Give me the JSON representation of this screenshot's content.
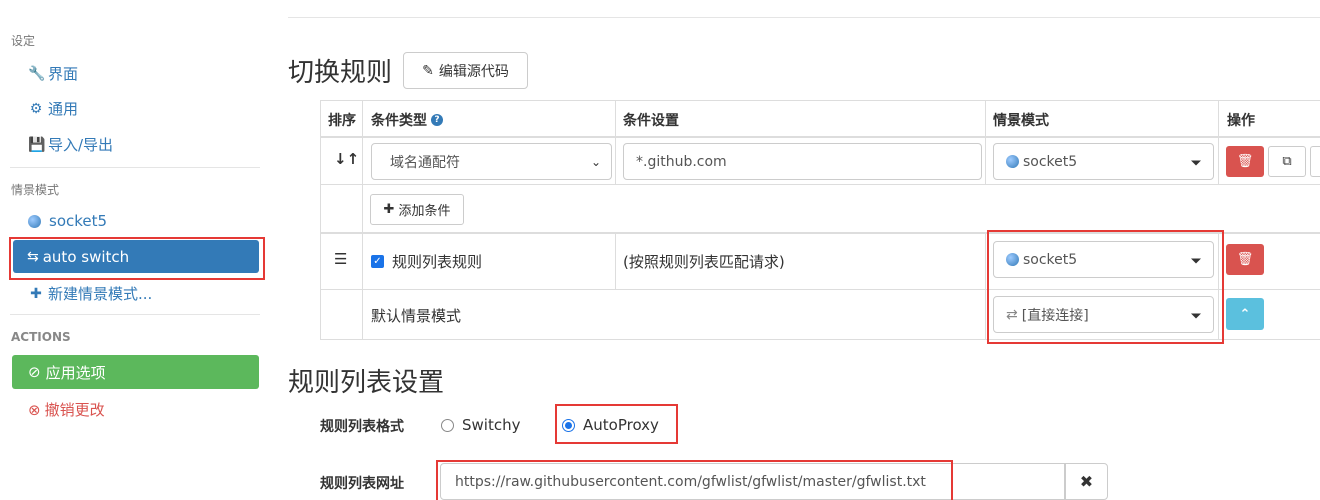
{
  "sidebar": {
    "settings_header": "设定",
    "items_settings": [
      {
        "label": "界面",
        "icon": "wrench-icon"
      },
      {
        "label": "通用",
        "icon": "gear-icon"
      },
      {
        "label": "导入/导出",
        "icon": "floppy-icon"
      }
    ],
    "profiles_header": "情景模式",
    "profiles": [
      {
        "label": "socket5",
        "icon": "globe-icon"
      },
      {
        "label": "auto switch",
        "icon": "retweet-icon",
        "active": true
      },
      {
        "label": "新建情景模式...",
        "icon": "plus-icon"
      }
    ],
    "actions_header": "ACTIONS",
    "apply_label": "应用选项",
    "discard_label": "撤销更改"
  },
  "switch_rules": {
    "title": "切换规则",
    "edit_source_label": "编辑源代码",
    "headers": {
      "sort": "排序",
      "condition_type": "条件类型",
      "condition_setting": "条件设置",
      "profile": "情景模式",
      "actions": "操作"
    },
    "rule": {
      "condition_type": "域名通配符",
      "condition_value": "*.github.com",
      "profile": "socket5"
    },
    "add_condition_label": "添加条件",
    "rule_list_row": {
      "label": "规则列表规则",
      "desc": "(按照规则列表匹配请求)",
      "profile": "socket5"
    },
    "default_row": {
      "label": "默认情景模式",
      "profile": "[直接连接]"
    }
  },
  "rule_list_settings": {
    "title": "规则列表设置",
    "format_label": "规则列表格式",
    "format_options": [
      "Switchy",
      "AutoProxy"
    ],
    "format_selected": "AutoProxy",
    "url_label": "规则列表网址",
    "url_value": "https://raw.githubusercontent.com/gfwlist/gfwlist/master/gfwlist.txt"
  },
  "colors": {
    "link": "#337ab7",
    "active_bg": "#337ab7",
    "apply_bg": "#5cb85c",
    "danger": "#d9534f",
    "info": "#5bc0de",
    "highlight": "#e53935"
  }
}
